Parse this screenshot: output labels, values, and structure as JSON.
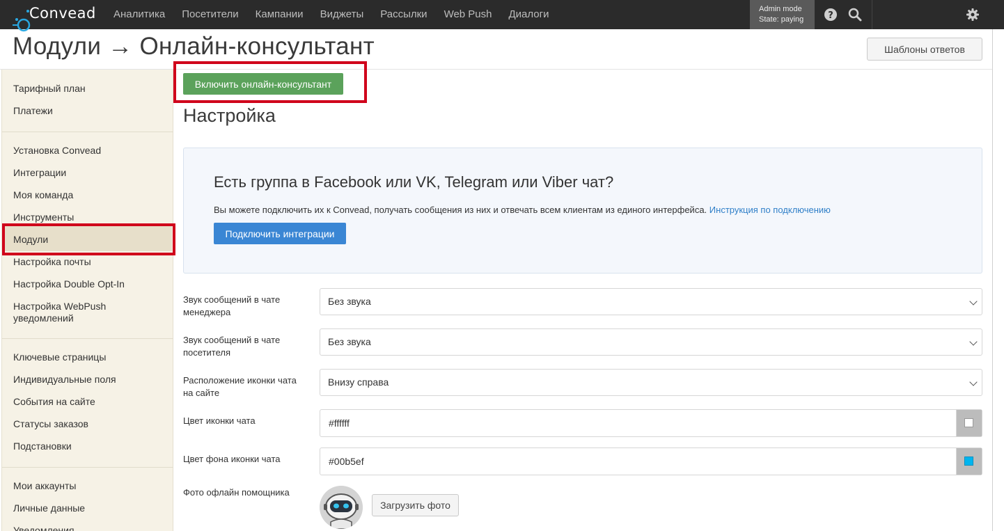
{
  "app": {
    "logo_text": "Convead",
    "nav": [
      "Аналитика",
      "Посетители",
      "Кампании",
      "Виджеты",
      "Рассылки",
      "Web Push",
      "Диалоги"
    ],
    "admin_mode": "Admin mode",
    "state": "State: paying",
    "icons": [
      "help-icon",
      "search-icon",
      "gear-icon"
    ]
  },
  "header": {
    "title": "Модули → Онлайн-консультант",
    "templates_button": "Шаблоны ответов"
  },
  "sidebar": {
    "items": [
      "Тарифный план",
      "Платежи",
      "Установка Convead",
      "Интеграции",
      "Моя команда",
      "Инструменты",
      "Модули",
      "Настройка почты",
      "Настройка Double Opt-In",
      "Настройка WebPush\nуведомлений",
      "Ключевые страницы",
      "Индивидуальные поля",
      "События на сайте",
      "Статусы заказов",
      "Подстановки",
      "Мои аккаунты",
      "Личные данные",
      "Уведомления"
    ],
    "active": "Модули"
  },
  "main": {
    "enable_button": "Включить онлайн-консультант",
    "section_title": "Настройка",
    "promo": {
      "title": "Есть группа в Facebook или VK, Telegram или Viber чат?",
      "text": "Вы можете подключить их к Convead, получать сообщения из них и отвечать всем клиентам из единого интерфейса.",
      "link": "Инструкция по подключению",
      "button": "Подключить интеграции"
    },
    "fields": {
      "manager_sound_label": "Звук сообщений в чате менеджера",
      "manager_sound_value": "Без звука",
      "visitor_sound_label": "Звук сообщений в чате посетителя",
      "visitor_sound_value": "Без звука",
      "icon_position_label": "Расположение иконки чата на сайте",
      "icon_position_value": "Внизу справа",
      "icon_color_label": "Цвет иконки чата",
      "icon_color_value": "#ffffff",
      "icon_bg_label": "Цвет фона иконки чата",
      "icon_bg_value": "#00b5ef",
      "photo_label": "Фото офлайн помощника",
      "upload_button": "Загрузить фото"
    }
  },
  "colors": {
    "topbar": "#2b2b2b",
    "sidebar": "#f6f2e6",
    "highlight": "#d0021b",
    "green_button": "#5ba25b",
    "blue_button": "#3a86d4",
    "link": "#2f7fc8"
  }
}
